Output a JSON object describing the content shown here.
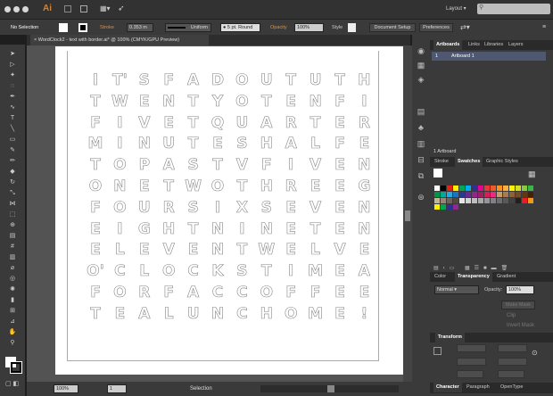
{
  "app": {
    "logo": "Ai",
    "workspace": "Layout",
    "search_placeholder": ""
  },
  "control": {
    "selection": "No Selection",
    "stroke_label": "Stroke",
    "stroke_value": "0.353 m",
    "profile": "Uniform",
    "brush": "5 pt. Round",
    "opacity_label": "Opacity",
    "opacity_value": "100%",
    "style_label": "Style",
    "document_setup": "Document Setup",
    "preferences": "Preferences"
  },
  "document": {
    "tab": "WordClock2 - text with border.ai* @ 100% (CMYK/GPU Preview)"
  },
  "grid": [
    "IT'SFADOUTUTH",
    "TWENTYOTENFI",
    "FIVETQUARTER",
    "MINUTESHALFE",
    "TOPASTVFIVEN",
    "ONETWOTHREEG",
    "FOURSIXSEVEN",
    "EIGHTNINETEN",
    "ELEVENTWELVE",
    "O'CLOCKSTIMEA",
    "FORFACCOFFEE",
    "TEALUNCHOME!"
  ],
  "grid_cells": [
    [
      "I",
      "T'",
      "S",
      "F",
      "A",
      "D",
      "O",
      "U",
      "T",
      "U",
      "T",
      "H"
    ],
    [
      "T",
      "W",
      "E",
      "N",
      "T",
      "Y",
      "O",
      "T",
      "E",
      "N",
      "F",
      "I"
    ],
    [
      "F",
      "I",
      "V",
      "E",
      "T",
      "Q",
      "U",
      "A",
      "R",
      "T",
      "E",
      "R"
    ],
    [
      "M",
      "I",
      "N",
      "U",
      "T",
      "E",
      "S",
      "H",
      "A",
      "L",
      "F",
      "E"
    ],
    [
      "T",
      "O",
      "P",
      "A",
      "S",
      "T",
      "V",
      "F",
      "I",
      "V",
      "E",
      "N"
    ],
    [
      "O",
      "N",
      "E",
      "T",
      "W",
      "O",
      "T",
      "H",
      "R",
      "E",
      "E",
      "G"
    ],
    [
      "F",
      "O",
      "U",
      "R",
      "S",
      "I",
      "X",
      "S",
      "E",
      "V",
      "E",
      "N"
    ],
    [
      "E",
      "I",
      "G",
      "H",
      "T",
      "N",
      "I",
      "N",
      "E",
      "T",
      "E",
      "N"
    ],
    [
      "E",
      "L",
      "E",
      "V",
      "E",
      "N",
      "T",
      "W",
      "E",
      "L",
      "V",
      "E"
    ],
    [
      "O'",
      "C",
      "L",
      "O",
      "C",
      "K",
      "S",
      "T",
      "I",
      "M",
      "E",
      "A"
    ],
    [
      "F",
      "O",
      "R",
      "F",
      "A",
      "C",
      "C",
      "O",
      "F",
      "F",
      "E",
      "E"
    ],
    [
      "T",
      "E",
      "A",
      "L",
      "U",
      "N",
      "C",
      "H",
      "O",
      "M",
      "E",
      "!"
    ]
  ],
  "status": {
    "zoom": "100%",
    "artboard": "1",
    "tool": "Selection"
  },
  "panels": {
    "artboards": {
      "tabs": [
        "Artboards",
        "Links",
        "Libraries",
        "Layers"
      ],
      "row_num": "1",
      "row_name": "Artboard 1",
      "footer": "1 Artboard"
    },
    "swatches": {
      "tabs": [
        "Stroke",
        "Swatches",
        "Graphic Styles"
      ]
    },
    "transparency": {
      "tabs": [
        "Color",
        "Transparency",
        "Gradient"
      ],
      "mode": "Normal",
      "opacity_label": "Opacity:",
      "opacity": "100%",
      "make_mask": "Make Mask",
      "clip": "Clip",
      "invert": "Invert Mask"
    },
    "transform": {
      "title": "Transform"
    },
    "character": {
      "tabs": [
        "Character",
        "Paragraph",
        "OpenType"
      ]
    }
  },
  "swatch_colors": [
    "#ffffff",
    "#000000",
    "#e2231a",
    "#ffee00",
    "#00a651",
    "#00aeef",
    "#2e3192",
    "#ec008c",
    "#e8383d",
    "#f15a24",
    "#f7931e",
    "#fbb040",
    "#fff200",
    "#d7df23",
    "#8dc63f",
    "#39b54a",
    "#009444",
    "#00a99d",
    "#27aae1",
    "#1c75bc",
    "#2b3990",
    "#662d91",
    "#92278f",
    "#9e1f63",
    "#da1c5c",
    "#ee2a7b",
    "#c69c6d",
    "#a67c52",
    "#8c6239",
    "#754c24",
    "#603813",
    "#42210b",
    "#c2b59b",
    "#998675",
    "#736357",
    "#534741",
    "#e6e7e8",
    "#d1d3d4",
    "#bcbec0",
    "#a7a9ac",
    "#939598",
    "#808285",
    "#6d6e71",
    "#58595b",
    "#414042",
    "#231f20",
    "#ed1c24",
    "#f7941d",
    "#fff200",
    "#00a651",
    "#2e3192",
    "#92278f"
  ]
}
